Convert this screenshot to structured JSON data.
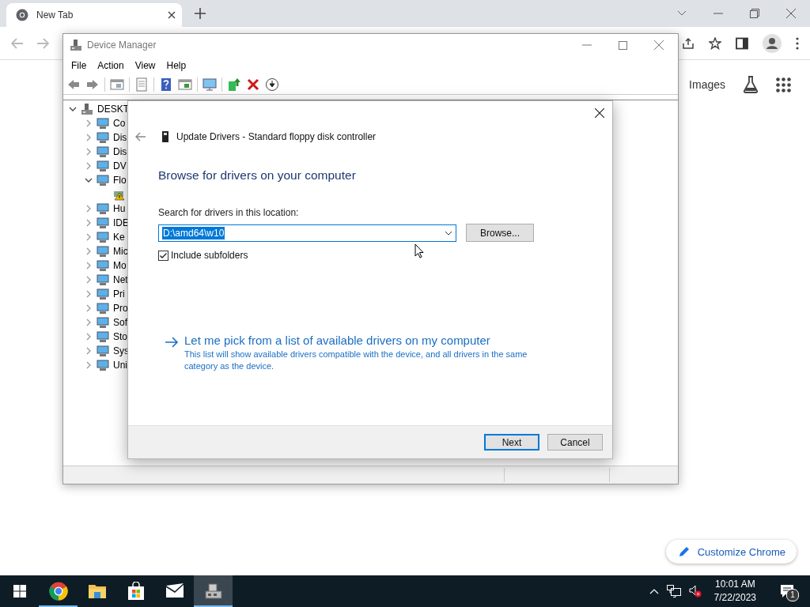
{
  "browser": {
    "tabs": [
      {
        "title": "New Tab",
        "selected": true
      }
    ],
    "page_links": [
      "Images"
    ],
    "customize_button": "Customize Chrome"
  },
  "device_manager": {
    "title": "Device Manager",
    "menu": [
      "File",
      "Action",
      "View",
      "Help"
    ],
    "tree": {
      "label": "DESKT",
      "expanded": true,
      "children": [
        {
          "label": "Co",
          "expanded": false
        },
        {
          "label": "Dis",
          "expanded": false
        },
        {
          "label": "Dis",
          "expanded": false
        },
        {
          "label": "DV",
          "expanded": false
        },
        {
          "label": "Flo",
          "expanded": true,
          "children": [
            {
              "warning": true
            }
          ]
        },
        {
          "label": "Hu",
          "expanded": false
        },
        {
          "label": "IDE",
          "expanded": false
        },
        {
          "label": "Ke",
          "expanded": false
        },
        {
          "label": "Mic",
          "expanded": false
        },
        {
          "label": "Mo",
          "expanded": false
        },
        {
          "label": "Net",
          "expanded": false
        },
        {
          "label": "Pri",
          "expanded": false
        },
        {
          "label": "Pro",
          "expanded": false
        },
        {
          "label": "Sof",
          "expanded": false
        },
        {
          "label": "Sto",
          "expanded": false
        },
        {
          "label": "Sys",
          "expanded": false
        },
        {
          "label": "Uni",
          "expanded": false
        }
      ]
    }
  },
  "dialog": {
    "title": "Update Drivers - Standard floppy disk controller",
    "heading": "Browse for drivers on your computer",
    "location_label": "Search for drivers in this location:",
    "location": {
      "value": "D:\\amd64\\w10",
      "text_selected": true
    },
    "browse_button": "Browse...",
    "include_subfolders": {
      "label": "Include subfolders",
      "checked": true
    },
    "pick_link": {
      "title": "Let me pick from a list of available drivers on my computer",
      "description": "This list will show available drivers compatible with the device, and all drivers in the same category as the device."
    },
    "buttons": [
      {
        "label": "Next",
        "default": true
      },
      {
        "label": "Cancel",
        "default": false
      }
    ]
  },
  "taskbar": {
    "apps": [
      {
        "kind": "chrome",
        "running": true,
        "active": false
      },
      {
        "kind": "explorer",
        "running": false,
        "active": false
      },
      {
        "kind": "store",
        "running": false,
        "active": false
      },
      {
        "kind": "mail",
        "running": false,
        "active": false
      },
      {
        "kind": "devmgr",
        "running": true,
        "active": true
      }
    ],
    "time": "10:01 AM",
    "date": "7/22/2023",
    "notifications": "1"
  }
}
